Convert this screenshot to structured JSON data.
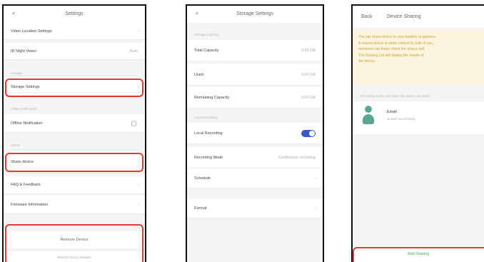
{
  "phone1": {
    "header": {
      "back": "<",
      "title": "Settings"
    },
    "rows": {
      "video_location": "Video Location Settings",
      "ir_night_vision": "IR Night Vision",
      "ir_night_vision_value": "Auto",
      "storage_settings": "Storage Settings",
      "offline_notification": "Offline Notification",
      "share_device": "Share device",
      "faq": "FAQ & Feedback",
      "firmware": "Firmware Information"
    },
    "sections": {
      "storage": "Storage",
      "offline": "Offline Notification",
      "other": "Others"
    },
    "bottom": {
      "remove_device": "Remove Device",
      "restore": "Restore factory defaults"
    }
  },
  "phone2": {
    "header": {
      "back": "<",
      "title": "Storage Settings"
    },
    "sections": {
      "storage_capacity": "Storage Capacity",
      "local_recording": "Local Recording"
    },
    "rows": {
      "total_capacity": "Total Capacity",
      "total_capacity_value": "0.00 GB",
      "used": "Used",
      "used_value": "0.00 GB",
      "remaining_capacity": "Remaining Capacity",
      "remaining_capacity_value": "0.00 GB",
      "local_recording": "Local Recording",
      "recording_mode": "Recording Mode",
      "recording_mode_value": "Continuous recording",
      "schedule": "Schedule",
      "format": "Format"
    },
    "toggle_on": true
  },
  "phone3": {
    "header": {
      "back": "Back",
      "title": "Device Sharing"
    },
    "banner": [
      "You can share device to your families or partners.",
      "A shared device is under control by both of you,",
      "members can freely check the device and",
      "The Sharing List will display the details of",
      "the device."
    ],
    "hint": "All members who can share this device are listed",
    "user": {
      "name": "Email",
      "sub": "Shared successfully"
    },
    "footer": "Add Sharing"
  },
  "colors": {
    "highlight": "#e53935",
    "toggle": "#3a57c8",
    "accent": "#4caf50",
    "banner": "#fdf5dd"
  }
}
